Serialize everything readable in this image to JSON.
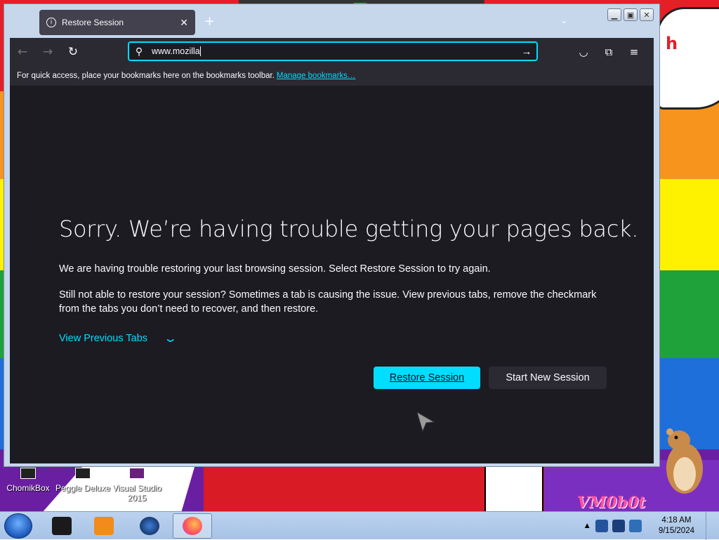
{
  "window": {
    "tab_title": "Restore Session",
    "url_text": "www.mozilla",
    "bookmarks_hint": "For quick access, place your bookmarks here on the bookmarks toolbar.",
    "manage_bookmarks": "Manage bookmarks…"
  },
  "page": {
    "heading": "Sorry. We’re having trouble getting your pages back.",
    "para1": "We are having trouble restoring your last browsing session. Select Restore Session to try again.",
    "para2": "Still not able to restore your session? Sometimes a tab is causing the issue. View previous tabs, remove the checkmark from the tabs you don’t need to recover, and then restore.",
    "view_previous_tabs": "View Previous Tabs",
    "restore_button": "Restore Session",
    "new_session_button": "Start New Session"
  },
  "desktop": {
    "icons": [
      "ChomikBox",
      "Peggle Deluxe",
      "Visual Studio 2015"
    ],
    "overlay_text": "VM0b0t",
    "speech_text": "h"
  },
  "taskbar": {
    "time": "4:18 AM",
    "date": "9/15/2024"
  },
  "colors": {
    "accent": "#00ddff",
    "content_bg": "#1c1b22",
    "toolbar_bg": "#2b2a33"
  }
}
